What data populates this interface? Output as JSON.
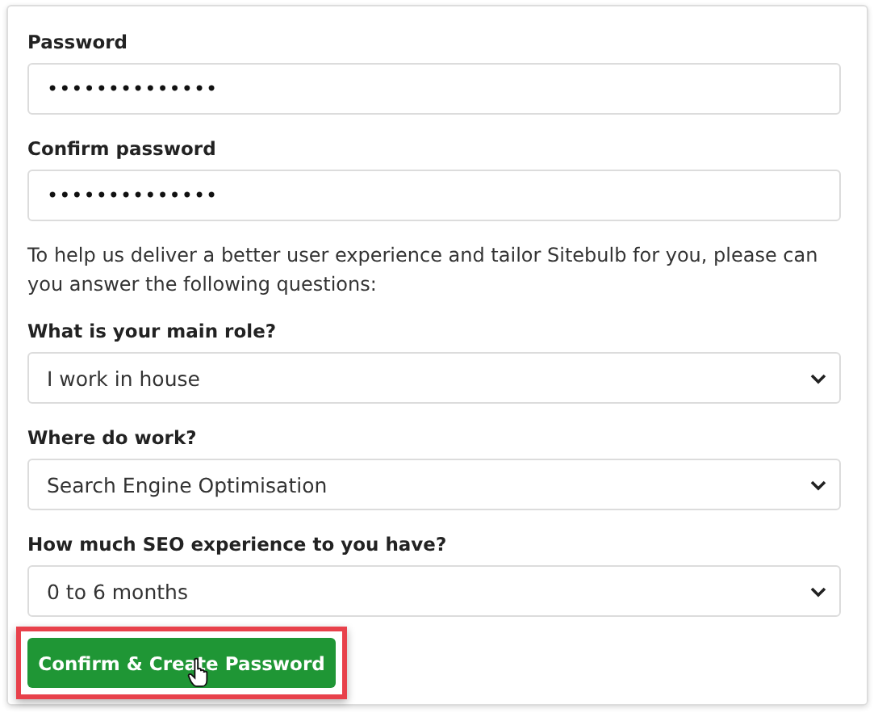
{
  "form": {
    "fields": [
      {
        "kind": "password",
        "label": "Password",
        "value": "••••••••••••••"
      },
      {
        "kind": "password",
        "label": "Confirm password",
        "value": "••••••••••••••"
      },
      {
        "kind": "intro",
        "text": "To help us deliver a better user experience and tailor Sitebulb for you, please can you answer the following questions:"
      },
      {
        "kind": "select",
        "label": "What is your main role?",
        "value": "I work in house"
      },
      {
        "kind": "select",
        "label": "Where do work?",
        "value": "Search Engine Optimisation"
      },
      {
        "kind": "select",
        "label": "How much SEO experience to you have?",
        "value": "0 to 6 months"
      }
    ],
    "submit": {
      "label": "Confirm & Create Password",
      "highlighted": true
    }
  }
}
